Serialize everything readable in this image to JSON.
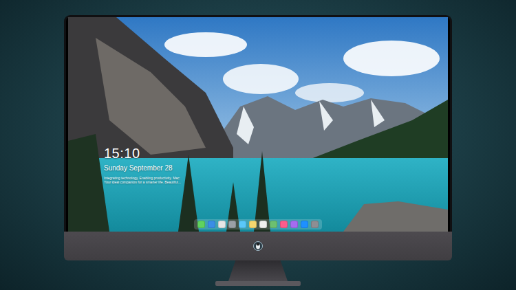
{
  "lock_screen": {
    "time": "15:10",
    "date": "Sunday September 28",
    "tagline": "Integrating technology, Enabling productivity. Mac: Your ideal companion for a smarter life. Beautiful..."
  },
  "dock": {
    "items": [
      {
        "color": "#5fd35f"
      },
      {
        "color": "#3a8ee6"
      },
      {
        "color": "#e6e6e6"
      },
      {
        "color": "#9aa0a6"
      },
      {
        "color": "#5ac8fa"
      },
      {
        "color": "#f5d76e"
      },
      {
        "color": "#f0f0f0"
      },
      {
        "color": "#6cc070"
      },
      {
        "color": "#fc5c8c"
      },
      {
        "color": "#a56cf0"
      },
      {
        "color": "#1e90ff"
      },
      {
        "color": "#8e8e93"
      }
    ]
  }
}
